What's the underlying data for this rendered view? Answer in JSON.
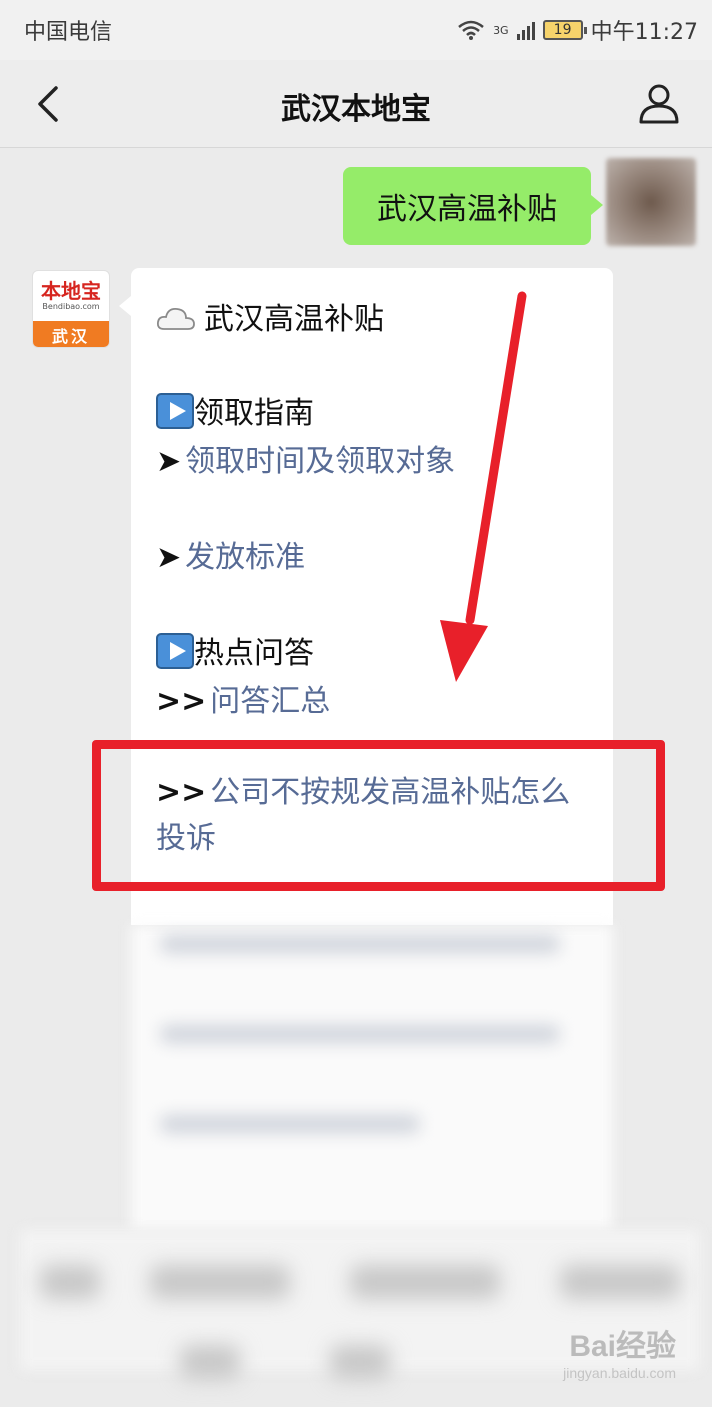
{
  "status_bar": {
    "carrier": "中国电信",
    "network": "3G",
    "battery": "19",
    "time": "中午11:27"
  },
  "navbar": {
    "title": "武汉本地宝",
    "back_icon": "chevron-left-icon",
    "user_icon": "person-icon"
  },
  "chat": {
    "my_message": "武汉高温补贴",
    "bot_avatar": {
      "logo": "本地宝",
      "url_text": "Bendibao.com",
      "city": "武汉"
    },
    "reply": {
      "title": "武汉高温补贴",
      "section1": "领取指南",
      "link1_bullet": "➤",
      "link1": "领取时间及领取对象",
      "link2_bullet": "➤",
      "link2": "发放标准",
      "section2": "热点问答",
      "link3_bullet": ">>",
      "link3": "问答汇总",
      "link4_bullet": ">>",
      "link4": "公司不按规发高温补贴怎么投诉"
    }
  },
  "watermark": {
    "brand": "Bai经验",
    "url": "jingyan.baidu.com"
  },
  "colors": {
    "my_bubble": "#95ec69",
    "link": "#576b95",
    "annotation": "#e8202a",
    "accent_orange": "#f07b22"
  }
}
